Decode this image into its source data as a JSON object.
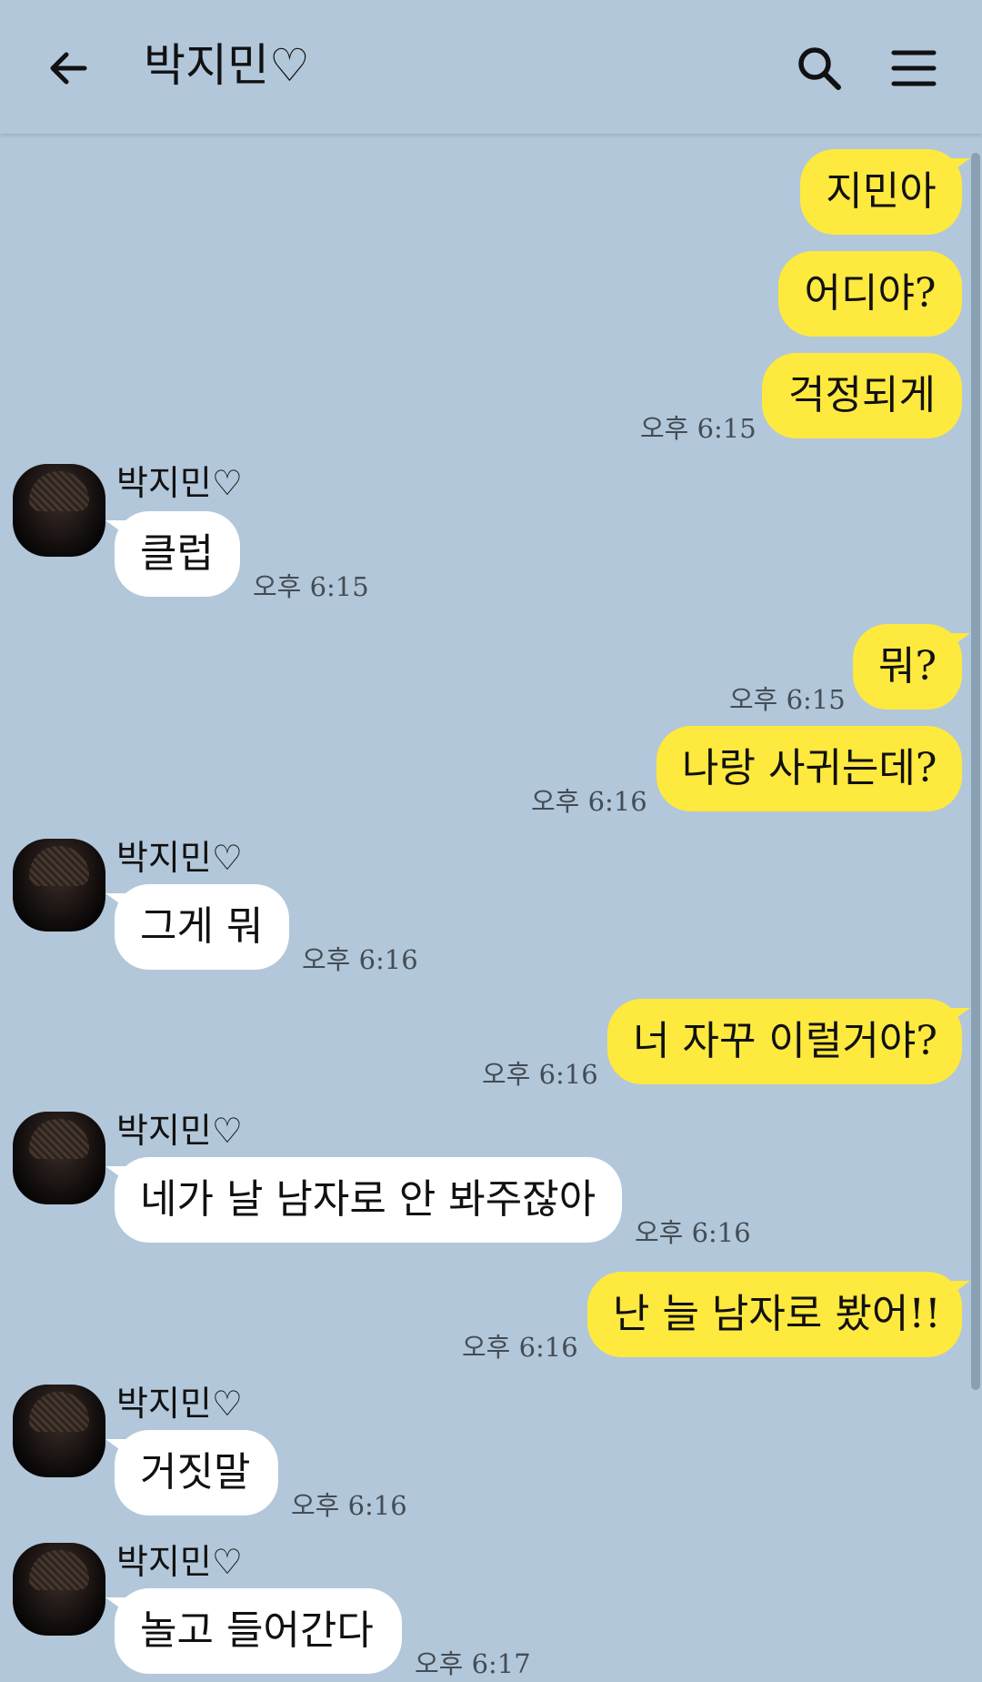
{
  "header": {
    "title": "박지민♡"
  },
  "messages": [
    {
      "side": "me",
      "text": "지민아"
    },
    {
      "side": "me",
      "text": "어디야?"
    },
    {
      "side": "me",
      "text": "걱정되게",
      "time": "오후 6:15"
    },
    {
      "side": "other",
      "sender": "박지민♡",
      "text": "클럽",
      "time": "오후 6:15"
    },
    {
      "side": "me",
      "text": "뭐?",
      "time": "오후 6:15"
    },
    {
      "side": "me",
      "text": "나랑 사귀는데?",
      "time": "오후 6:16"
    },
    {
      "side": "other",
      "sender": "박지민♡",
      "text": "그게 뭐",
      "time": "오후 6:16"
    },
    {
      "side": "me",
      "text": "너 자꾸 이럴거야?",
      "time": "오후 6:16"
    },
    {
      "side": "other",
      "sender": "박지민♡",
      "text": "네가 날 남자로 안 봐주잖아",
      "time": "오후 6:16"
    },
    {
      "side": "me",
      "text": "난 늘 남자로 봤어!!",
      "time": "오후 6:16"
    },
    {
      "side": "other",
      "sender": "박지민♡",
      "text": "거짓말",
      "time": "오후 6:16"
    },
    {
      "side": "other",
      "sender": "박지민♡",
      "text": "놀고 들어간다",
      "time": "오후 6:17"
    }
  ],
  "colors": {
    "background": "#b2c7da",
    "my_bubble": "#fee93e",
    "their_bubble": "#ffffff"
  },
  "icons": [
    "back-arrow-icon",
    "search-icon",
    "menu-icon"
  ]
}
